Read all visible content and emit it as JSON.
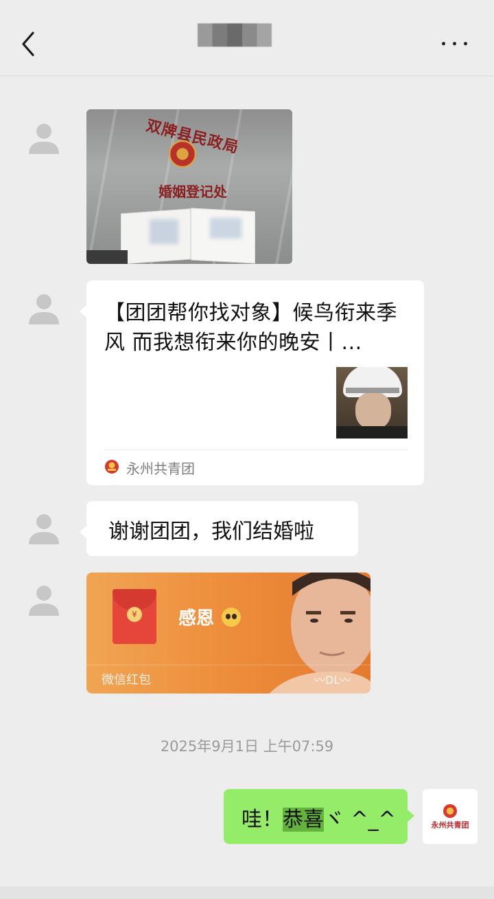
{
  "header": {
    "back_icon": "chevron-left-icon",
    "more_icon": "more-dots-icon"
  },
  "messages": {
    "photo": {
      "sign_top": "双牌县民政局",
      "sign_bottom": "婚姻登记处"
    },
    "article": {
      "title": "【团团帮你找对象】候鸟衔来季风 而我想衔来你的晚安丨...",
      "source": "永州共青团"
    },
    "text": "谢谢团团，我们结婚啦",
    "red_packet": {
      "greeting": "感恩",
      "label": "微信红包",
      "mark": "〰DL〰",
      "coin": "¥"
    },
    "timestamp": "2025年9月1日 上午07:59",
    "outgoing": {
      "prefix": "哇！",
      "highlight": "恭喜",
      "suffix": "ヾ ^_^"
    }
  },
  "self_avatar": {
    "text": "永州共青团"
  },
  "colors": {
    "background": "#ededed",
    "outgoing_bubble": "#95ec69",
    "red_packet": "#ee8f3d"
  }
}
